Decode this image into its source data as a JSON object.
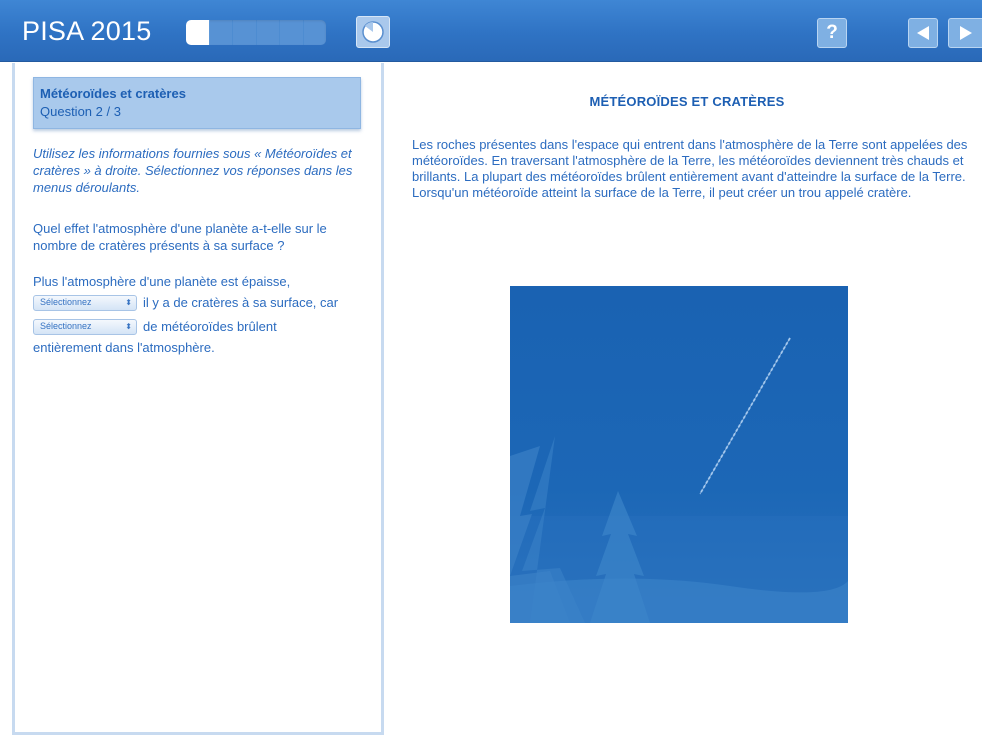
{
  "header": {
    "app_title": "PISA 2015",
    "progress": {
      "segments": 6,
      "completed": 1
    },
    "help_label": "?",
    "icons": {
      "timer": "timer-icon",
      "help": "help-icon",
      "prev": "arrow-left-icon",
      "next": "arrow-right-icon"
    }
  },
  "question_panel": {
    "unit_title": "Météoroïdes et cratères",
    "question_number": "Question 2 / 3",
    "instructions": "Utilisez les informations fournies sous « Météoroïdes et cratères » à droite. Sélectionnez vos réponses dans les menus déroulants.",
    "question": "Quel effet l'atmosphère d'une planète a-t-elle sur le nombre de cratères présents à sa surface ?",
    "answer": {
      "intro": "Plus l'atmosphère d'une planète est épaisse,",
      "dropdown_1": "Sélectionnez",
      "middle": "il y a de cratères à sa surface, car",
      "dropdown_2": "Sélectionnez",
      "after": "de météoroïdes brûlent",
      "end": "entièrement dans l'atmosphère."
    }
  },
  "stimulus": {
    "title": "MÉTÉOROÏDES ET CRATÈRES",
    "text": "Les roches présentes dans l'espace qui entrent dans l'atmosphère de la Terre sont appelées des météoroïdes. En traversant l'atmosphère de la Terre, les météoroïdes deviennent très chauds et brillants. La plupart des météoroïdes brûlent entièrement avant d'atteindre la surface de la Terre. Lorsqu'un météoroïde atteint la surface de la Terre, il peut créer un trou appelé cratère."
  },
  "colors": {
    "header_bar": "#2f73c4",
    "text_blue": "#2c6cc0",
    "panel_border": "#c7daf0",
    "image_blue": "#1b64b3"
  }
}
